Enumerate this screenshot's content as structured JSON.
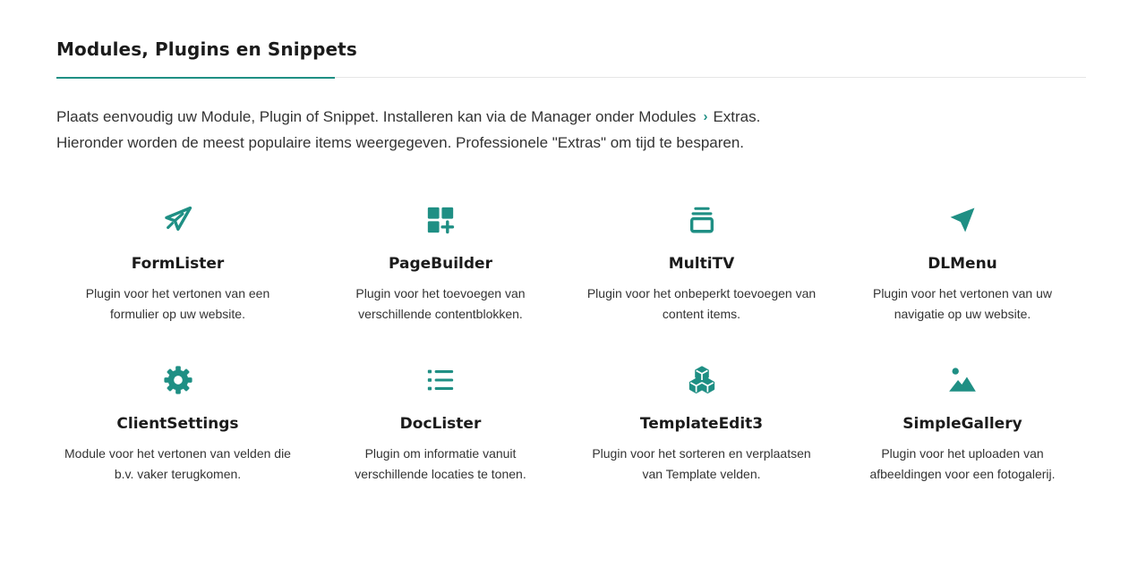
{
  "section": {
    "title": "Modules, Plugins en Snippets"
  },
  "intro": {
    "line1_part1": "Plaats eenvoudig uw Module, Plugin of Snippet. Installeren kan via de Manager onder Modules",
    "line1_chevron": "›",
    "line1_part2": "Extras.",
    "line2": "Hieronder worden de meest populaire items weergegeven. Professionele \"Extras\" om tijd te besparen."
  },
  "colors": {
    "accent": "#1f8f84"
  },
  "items": [
    {
      "icon": "paper-plane-icon",
      "name": "FormLister",
      "desc_line1": "Plugin voor het vertonen van een",
      "desc_line2": "formulier op uw website."
    },
    {
      "icon": "grid-add-icon",
      "name": "PageBuilder",
      "desc_line1": "Plugin voor het toevoegen van",
      "desc_line2": "verschillende contentblokken."
    },
    {
      "icon": "layers-icon",
      "name": "MultiTV",
      "desc_line1": "Plugin voor het onbeperkt toevoegen van",
      "desc_line2": "content items."
    },
    {
      "icon": "navigation-arrow-icon",
      "name": "DLMenu",
      "desc_line1": "Plugin voor het vertonen van uw",
      "desc_line2": "navigatie op uw website."
    },
    {
      "icon": "gear-icon",
      "name": "ClientSettings",
      "desc_line1": "Module voor het vertonen van velden die",
      "desc_line2": "b.v. vaker terugkomen."
    },
    {
      "icon": "list-icon",
      "name": "DocLister",
      "desc_line1": "Plugin om informatie vanuit",
      "desc_line2": "verschillende locaties te tonen."
    },
    {
      "icon": "cubes-icon",
      "name": "TemplateEdit3",
      "desc_line1": "Plugin voor het sorteren en verplaatsen",
      "desc_line2": "van Template velden."
    },
    {
      "icon": "image-icon",
      "name": "SimpleGallery",
      "desc_line1": "Plugin voor het uploaden van",
      "desc_line2": "afbeeldingen voor een fotogalerij."
    }
  ]
}
